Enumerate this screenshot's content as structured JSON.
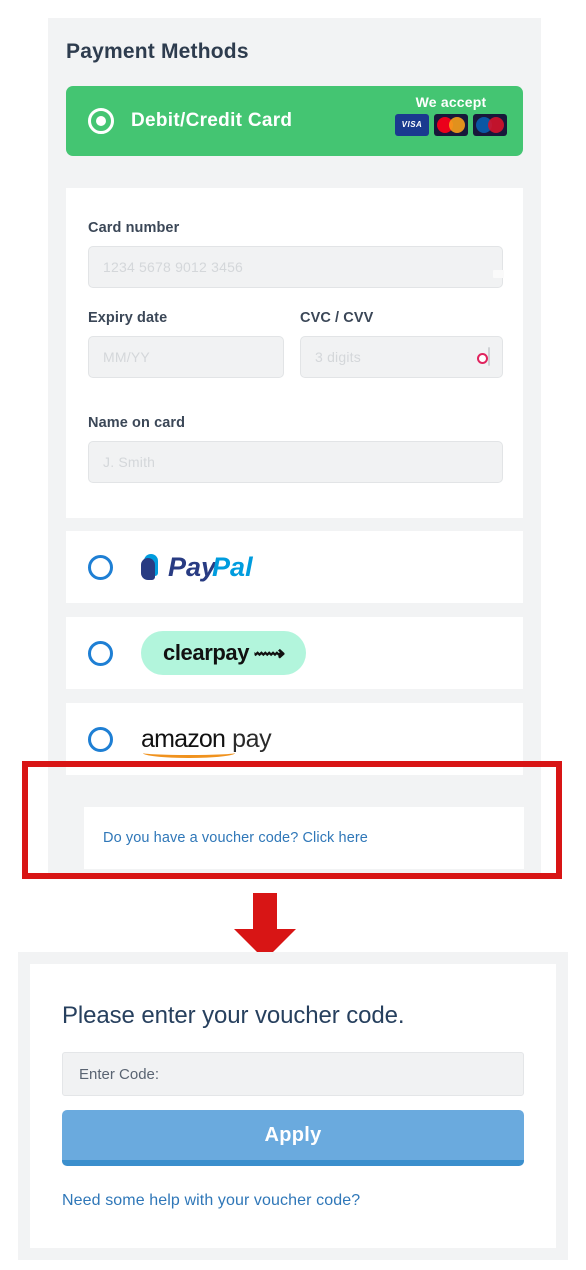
{
  "payment_methods": {
    "heading": "Payment Methods",
    "card_option": {
      "label": "Debit/Credit Card",
      "selected": true,
      "we_accept_label": "We accept",
      "accepted_brands": [
        "visa",
        "mastercard",
        "maestro"
      ],
      "header_color": "#44c572"
    },
    "card_form": {
      "card_number": {
        "label": "Card number",
        "placeholder": "1234 5678 9012 3456",
        "value": "",
        "icon": "credit-card-front-icon"
      },
      "expiry": {
        "label": "Expiry date",
        "placeholder": "MM/YY",
        "value": ""
      },
      "cvc": {
        "label": "CVC / CVV",
        "placeholder": "3 digits",
        "value": "",
        "icon": "credit-card-back-cvc-icon"
      },
      "name_on_card": {
        "label": "Name on card",
        "placeholder": "J. Smith",
        "value": ""
      }
    },
    "alternatives": [
      {
        "id": "paypal",
        "label": "PayPal",
        "selected": false,
        "brand_color": "#283b82"
      },
      {
        "id": "clearpay",
        "label": "clearpay",
        "selected": false,
        "brand_color": "#b2f5dc"
      },
      {
        "id": "amazonpay",
        "label": "amazon pay",
        "selected": false,
        "brand_color": "#f0921e"
      }
    ],
    "voucher_link": "Do you have a voucher code? Click here",
    "link_color": "#2f77b8"
  },
  "annotation": {
    "highlight_color": "#d81515",
    "arrow_color": "#d81515",
    "arrow_direction": "down"
  },
  "voucher_panel": {
    "title": "Please enter your voucher code.",
    "input_placeholder": "Enter Code:",
    "input_value": "",
    "apply_label": "Apply",
    "apply_color": "#6aaade",
    "help_link": "Need some help with your voucher code?"
  },
  "logos": {
    "paypal_pay": "Pay",
    "paypal_pal": "Pal",
    "clearpay_text": "clearpay",
    "clearpay_glyph": "⟿",
    "amazon_word": "amazon",
    "amazon_pay_word": "pay",
    "visa_text": "VISA"
  }
}
